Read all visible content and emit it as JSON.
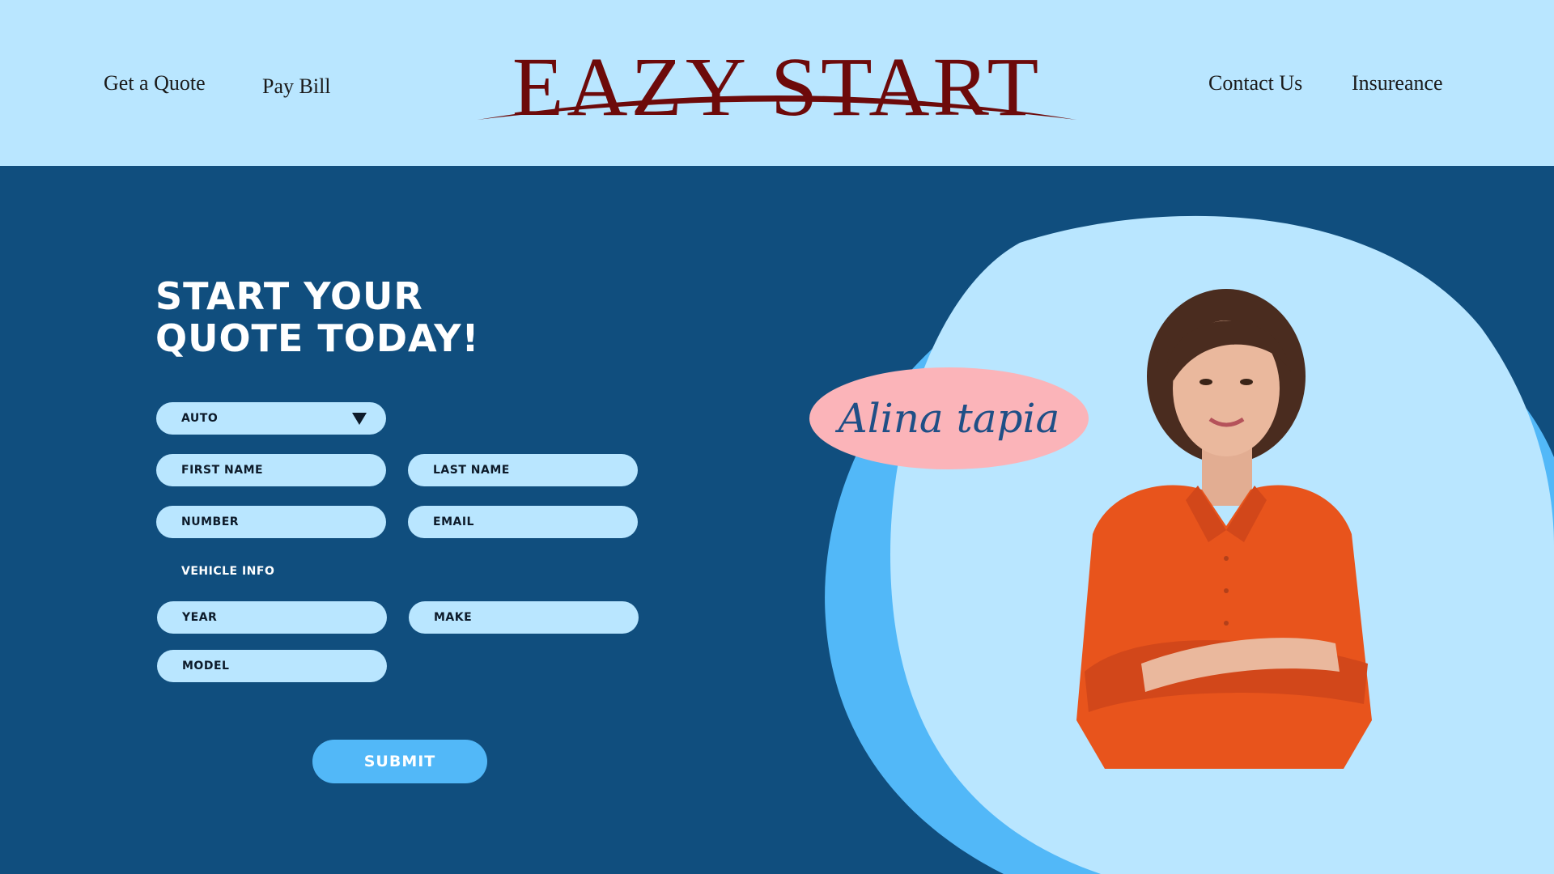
{
  "header": {
    "nav_left": [
      "Get a Quote",
      "Pay Bill"
    ],
    "logo": "EAZY START",
    "nav_right": [
      "Contact Us",
      "Insureance"
    ]
  },
  "form": {
    "title_line1": "START YOUR",
    "title_line2": "QUOTE TODAY!",
    "insurance_type": "AUTO",
    "first_name": "FIRST NAME",
    "last_name": "LAST NAME",
    "number": "NUMBER",
    "email": "EMAIL",
    "vehicle_section": "VEHICLE INFO",
    "year": "YEAR",
    "make": "MAKE",
    "model": "MODEL",
    "submit": "SUBMIT"
  },
  "agent": {
    "name": "Alina tapia"
  },
  "colors": {
    "header_bg": "#b9e6ff",
    "page_bg": "#104e7e",
    "logo": "#6d0a0a",
    "field_bg": "#b9e6ff",
    "accent_blue": "#52b8f8",
    "name_tag": "#fbb4b9",
    "shirt": "#e8541c"
  },
  "icons": {
    "dropdown": "triangle-down-icon"
  }
}
